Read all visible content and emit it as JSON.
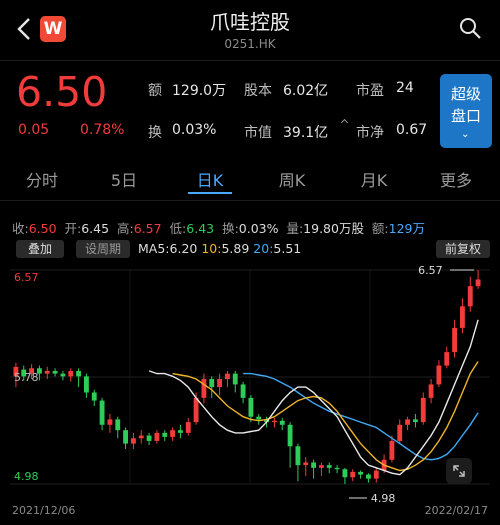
{
  "header": {
    "title": "爪哇控股",
    "code": "0251.HK",
    "logo_letter": "W"
  },
  "quote": {
    "price": "6.50",
    "change": "0.05",
    "change_pct": "0.78%",
    "fields": [
      {
        "label": "额",
        "value": "129.0万"
      },
      {
        "label": "股本",
        "value": "6.02亿"
      },
      {
        "label": "市盈",
        "value": "24"
      },
      {
        "label": "换",
        "value": "0.03%"
      },
      {
        "label": "市值",
        "value": "39.1亿"
      },
      {
        "label": "市净",
        "value": "0.67"
      }
    ],
    "super_button": {
      "line1": "超级",
      "line2": "盘口",
      "chevron": "⌄"
    }
  },
  "tabs": [
    "分时",
    "5日",
    "日K",
    "周K",
    "月K",
    "更多"
  ],
  "active_tab": "日K",
  "stats": {
    "close_label": "收:",
    "close": "6.50",
    "open_label": "开:",
    "open": "6.45",
    "high_label": "高:",
    "high": "6.57",
    "low_label": "低:",
    "low": "6.43",
    "turnover_label": "换:",
    "turnover": "0.03%",
    "volume_label": "量:",
    "volume": "19.80万股",
    "amount_label": "额:",
    "amount": "129万"
  },
  "chart_toolbar": {
    "overlay": "叠加",
    "period": "设周期",
    "ma5_label": "MA5:",
    "ma5": "6.20",
    "ma10_label": "10:",
    "ma10": "5.89",
    "ma20_label": "20:",
    "ma20": "5.51",
    "adjust": "前复权"
  },
  "colors": {
    "up": "#f23b3b",
    "down": "#2ecc58",
    "ma5": "#e9e9e9",
    "ma10": "#f0b429",
    "ma20": "#3fa9f5",
    "accent": "#4aa8ff"
  },
  "chart_data": {
    "type": "candlestick",
    "y_max_label": "6.57",
    "y_mid_label": "5.78",
    "y_min_label": "4.98",
    "x_start": "2021/12/06",
    "x_end": "2022/02/17",
    "high_marker": "6.57",
    "low_marker": "4.98",
    "ylim": [
      4.98,
      6.57
    ],
    "candles": [
      [
        5.78,
        5.85,
        5.7,
        5.88
      ],
      [
        5.83,
        5.78,
        5.75,
        5.86
      ],
      [
        5.8,
        5.84,
        5.76,
        5.87
      ],
      [
        5.84,
        5.8,
        5.75,
        5.86
      ],
      [
        5.8,
        5.82,
        5.76,
        5.85
      ],
      [
        5.82,
        5.8,
        5.78,
        5.84
      ],
      [
        5.8,
        5.78,
        5.75,
        5.82
      ],
      [
        5.78,
        5.82,
        5.74,
        5.84
      ],
      [
        5.82,
        5.78,
        5.7,
        5.84
      ],
      [
        5.78,
        5.66,
        5.62,
        5.8
      ],
      [
        5.66,
        5.6,
        5.56,
        5.68
      ],
      [
        5.6,
        5.42,
        5.38,
        5.62
      ],
      [
        5.42,
        5.46,
        5.36,
        5.5
      ],
      [
        5.46,
        5.38,
        5.32,
        5.48
      ],
      [
        5.38,
        5.28,
        5.24,
        5.4
      ],
      [
        5.28,
        5.32,
        5.24,
        5.36
      ],
      [
        5.32,
        5.34,
        5.28,
        5.38
      ],
      [
        5.34,
        5.3,
        5.27,
        5.36
      ],
      [
        5.3,
        5.36,
        5.28,
        5.38
      ],
      [
        5.36,
        5.33,
        5.3,
        5.38
      ],
      [
        5.33,
        5.38,
        5.3,
        5.4
      ],
      [
        5.38,
        5.36,
        5.32,
        5.42
      ],
      [
        5.36,
        5.44,
        5.34,
        5.47
      ],
      [
        5.44,
        5.62,
        5.42,
        5.66
      ],
      [
        5.62,
        5.76,
        5.58,
        5.8
      ],
      [
        5.76,
        5.7,
        5.62,
        5.78
      ],
      [
        5.7,
        5.76,
        5.64,
        5.8
      ],
      [
        5.76,
        5.8,
        5.7,
        5.82
      ],
      [
        5.8,
        5.72,
        5.66,
        5.82
      ],
      [
        5.72,
        5.62,
        5.58,
        5.74
      ],
      [
        5.62,
        5.48,
        5.44,
        5.64
      ],
      [
        5.48,
        5.46,
        5.42,
        5.5
      ],
      [
        5.46,
        5.44,
        5.4,
        5.48
      ],
      [
        5.44,
        5.45,
        5.4,
        5.47
      ],
      [
        5.45,
        5.42,
        5.38,
        5.47
      ],
      [
        5.42,
        5.26,
        5.1,
        5.44
      ],
      [
        5.26,
        5.12,
        5.0,
        5.28
      ],
      [
        5.12,
        5.14,
        5.04,
        5.18
      ],
      [
        5.14,
        5.1,
        5.02,
        5.16
      ],
      [
        5.1,
        5.12,
        5.04,
        5.14
      ],
      [
        5.12,
        5.1,
        5.06,
        5.14
      ],
      [
        5.1,
        5.09,
        5.06,
        5.12
      ],
      [
        5.09,
        5.03,
        4.98,
        5.1
      ],
      [
        5.03,
        5.07,
        5.0,
        5.09
      ],
      [
        5.07,
        5.05,
        5.02,
        5.08
      ],
      [
        5.05,
        5.02,
        4.99,
        5.06
      ],
      [
        5.02,
        5.08,
        4.99,
        5.1
      ],
      [
        5.08,
        5.16,
        5.06,
        5.2
      ],
      [
        5.16,
        5.3,
        5.14,
        5.34
      ],
      [
        5.3,
        5.42,
        5.28,
        5.46
      ],
      [
        5.42,
        5.46,
        5.38,
        5.48
      ],
      [
        5.46,
        5.44,
        5.4,
        5.5
      ],
      [
        5.44,
        5.62,
        5.42,
        5.66
      ],
      [
        5.62,
        5.72,
        5.58,
        5.76
      ],
      [
        5.72,
        5.86,
        5.7,
        5.9
      ],
      [
        5.86,
        5.96,
        5.84,
        6.0
      ],
      [
        5.96,
        6.14,
        5.92,
        6.2
      ],
      [
        6.14,
        6.3,
        6.1,
        6.36
      ],
      [
        6.3,
        6.45,
        6.26,
        6.52
      ],
      [
        6.45,
        6.5,
        6.43,
        6.57
      ]
    ],
    "ma5": [
      5.82,
      5.8,
      5.8,
      5.78,
      5.75,
      5.7,
      5.62,
      5.55,
      5.48,
      5.42,
      5.38,
      5.36,
      5.36,
      5.37,
      5.38,
      5.44,
      5.52,
      5.6,
      5.66,
      5.7,
      5.7,
      5.66,
      5.6,
      5.54,
      5.48,
      5.38,
      5.28,
      5.18,
      5.12,
      5.1,
      5.08,
      5.06,
      5.05,
      5.1,
      5.18,
      5.26,
      5.34,
      5.44,
      5.58,
      5.72,
      5.86,
      6.0,
      6.2
    ],
    "ma10": [
      5.8,
      5.79,
      5.78,
      5.76,
      5.72,
      5.68,
      5.62,
      5.56,
      5.52,
      5.48,
      5.46,
      5.45,
      5.46,
      5.48,
      5.52,
      5.56,
      5.6,
      5.62,
      5.63,
      5.62,
      5.58,
      5.52,
      5.44,
      5.36,
      5.28,
      5.22,
      5.16,
      5.12,
      5.1,
      5.08,
      5.09,
      5.12,
      5.16,
      5.22,
      5.3,
      5.4,
      5.52,
      5.66,
      5.8,
      5.89
    ],
    "ma20": [
      5.8,
      5.8,
      5.79,
      5.78,
      5.76,
      5.73,
      5.7,
      5.66,
      5.62,
      5.58,
      5.55,
      5.52,
      5.5,
      5.48,
      5.46,
      5.44,
      5.42,
      5.4,
      5.36,
      5.32,
      5.28,
      5.24,
      5.2,
      5.17,
      5.16,
      5.17,
      5.2,
      5.26,
      5.34,
      5.42,
      5.51
    ]
  }
}
